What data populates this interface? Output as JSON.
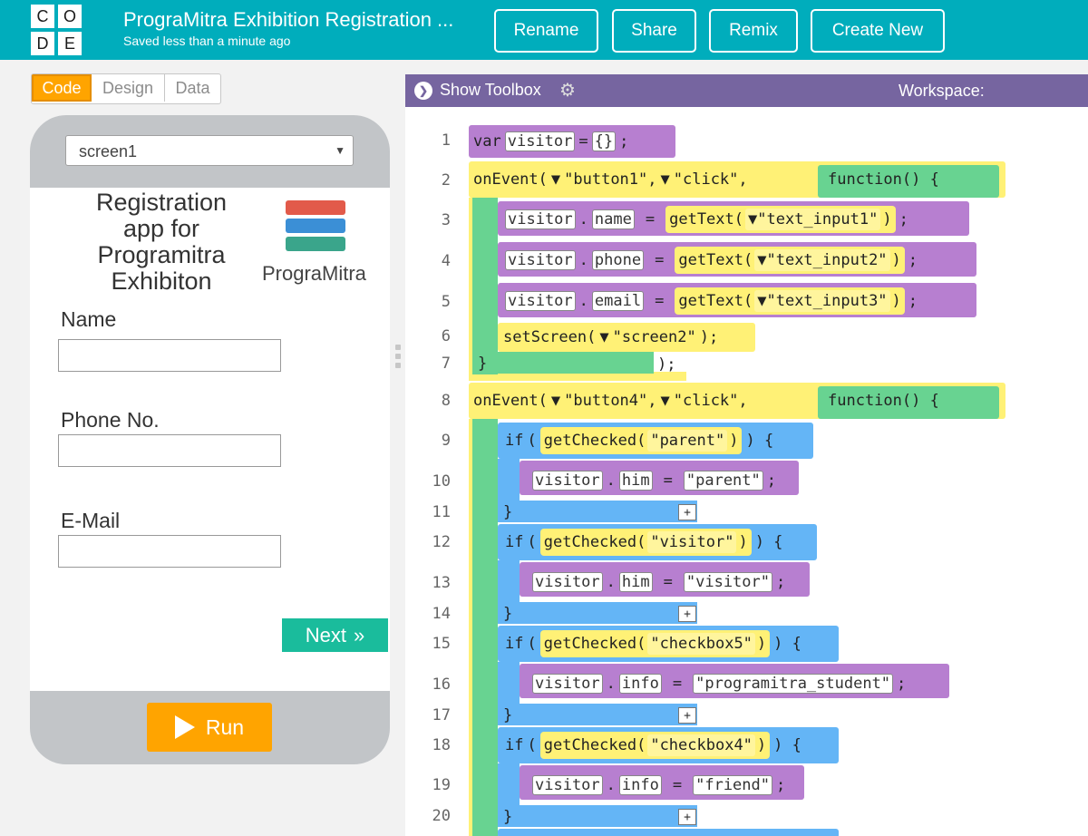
{
  "header": {
    "logo_letters": [
      "C",
      "O",
      "D",
      "E"
    ],
    "project_title": "PrograMitra Exhibition Registration ...",
    "saved_status": "Saved less than a minute ago",
    "buttons": {
      "rename": "Rename",
      "share": "Share",
      "remix": "Remix",
      "create_new": "Create New"
    }
  },
  "mode_toggle": {
    "code": "Code",
    "design": "Design",
    "data": "Data",
    "active": "Code"
  },
  "app_preview": {
    "screen_selector": "screen1",
    "title_lines": [
      "Registration",
      "app for",
      "Programitra",
      "Exhibiton"
    ],
    "logo_text": "PrograMitra",
    "logo_colors": [
      "#e25a4a",
      "#3b8fd6",
      "#3aa58b"
    ],
    "fields": [
      {
        "label": "Name"
      },
      {
        "label": "Phone No."
      },
      {
        "label": "E-Mail"
      }
    ],
    "next_button": "Next",
    "run_button": "Run"
  },
  "workspace": {
    "show_toolbox": "Show Toolbox",
    "label": "Workspace:",
    "line_numbers": [
      "1",
      "2",
      "3",
      "4",
      "5",
      "6",
      "7",
      "8",
      "9",
      "10",
      "11",
      "12",
      "13",
      "14",
      "15",
      "16",
      "17",
      "18",
      "19",
      "20"
    ],
    "colors": {
      "purple": "#b77fd0",
      "yellow": "#fff176",
      "green": "#68d391",
      "blue": "#64b5f6"
    },
    "code": {
      "l1": {
        "kw": "var",
        "name": "visitor",
        "eq": "=",
        "val": "{}",
        "end": ";"
      },
      "l2": {
        "fn": "onEvent(",
        "arg1": "\"button1\",",
        "arg2": "\"click\",",
        "func": "function() {"
      },
      "l3": {
        "obj": "visitor",
        "prop": "name",
        "eq": "=",
        "call": "getText(",
        "arg": "\"text_input1\"",
        "close": ")",
        "end": ";"
      },
      "l4": {
        "obj": "visitor",
        "prop": "phone",
        "eq": "=",
        "call": "getText(",
        "arg": "\"text_input2\"",
        "close": ")",
        "end": ";"
      },
      "l5": {
        "obj": "visitor",
        "prop": "email",
        "eq": "=",
        "call": "getText(",
        "arg": "\"text_input3\"",
        "close": ")",
        "end": ";"
      },
      "l6": {
        "call": "setScreen(",
        "arg": "\"screen2\"",
        "close": ");"
      },
      "l7": {
        "brace": "}",
        "close": ");"
      },
      "l8": {
        "fn": "onEvent(",
        "arg1": "\"button4\",",
        "arg2": "\"click\",",
        "func": "function() {"
      },
      "l9": {
        "kw": "if",
        "open": "(",
        "call": "getChecked(",
        "arg": "\"parent\"",
        "close": ")",
        "end": ") {"
      },
      "l10": {
        "obj": "visitor",
        "prop": "him",
        "eq": "=",
        "val": "\"parent\"",
        "end": ";"
      },
      "l12": {
        "kw": "if",
        "open": "(",
        "call": "getChecked(",
        "arg": "\"visitor\"",
        "close": ")",
        "end": ") {"
      },
      "l13": {
        "obj": "visitor",
        "prop": "him",
        "eq": "=",
        "val": "\"visitor\"",
        "end": ";"
      },
      "l15": {
        "kw": "if",
        "open": "(",
        "call": "getChecked(",
        "arg": "\"checkbox5\"",
        "close": ")",
        "end": ") {"
      },
      "l16": {
        "obj": "visitor",
        "prop": "info",
        "eq": "=",
        "val": "\"programitra_student\"",
        "end": ";"
      },
      "l18": {
        "kw": "if",
        "open": "(",
        "call": "getChecked(",
        "arg": "\"checkbox4\"",
        "close": ")",
        "end": ") {"
      },
      "l19": {
        "obj": "visitor",
        "prop": "info",
        "eq": "=",
        "val": "\"friend\"",
        "end": ";"
      },
      "brace": "}",
      "plus": "+",
      "dropdown": "▼"
    }
  }
}
